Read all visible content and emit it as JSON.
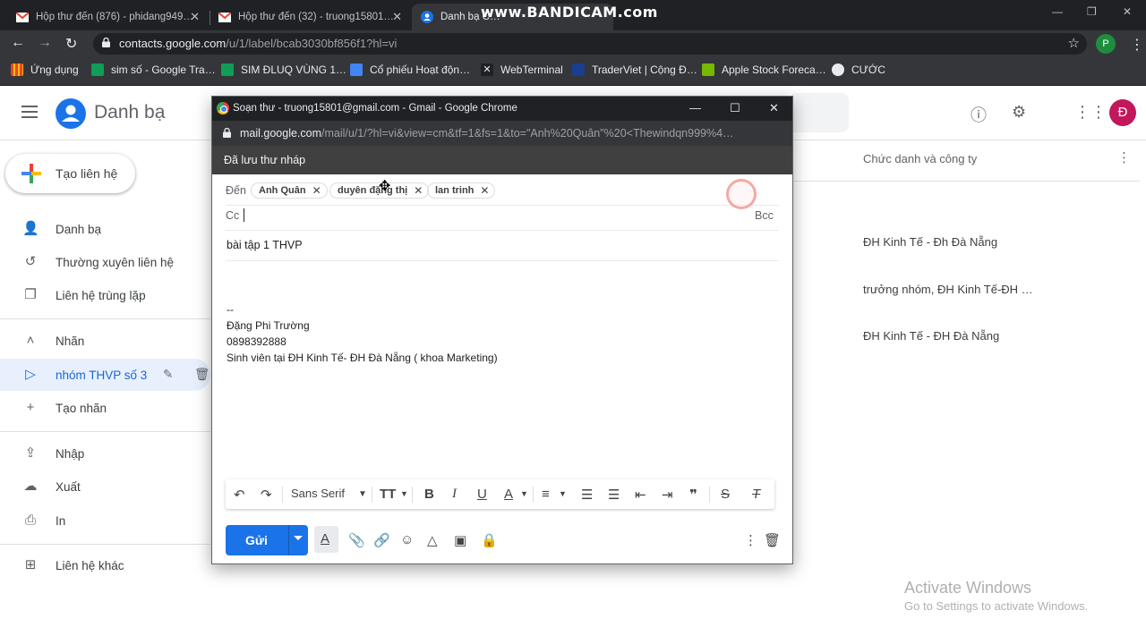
{
  "browser": {
    "tabs": [
      {
        "title": "Hộp thư đến (876) - phidang949…",
        "icon": "gmail-icon"
      },
      {
        "title": "Hộp thư đến (32) - truong15801…",
        "icon": "gmail-icon"
      },
      {
        "title": "Danh bạ C…",
        "icon": "contacts-icon"
      }
    ],
    "watermark": "www.BANDICAM.com",
    "address": {
      "host": "contacts.google.com",
      "path": "/u/1/label/bcab3030bf856f1?hl=vi"
    },
    "profile_initial": "P",
    "bookmarks": [
      {
        "label": "Ứng dụng",
        "icon": "apps-grid-icon",
        "color": "#ea4335"
      },
      {
        "label": "sim số - Google Tra…",
        "icon": "sheets-icon",
        "color": "#0f9d58"
      },
      {
        "label": "SIM ĐLUQ VÙNG 1…",
        "icon": "sheets-icon",
        "color": "#0f9d58"
      },
      {
        "label": "Cổ phiếu Hoạt độn…",
        "icon": "page-icon",
        "color": "#4285f4"
      },
      {
        "label": "WebTerminal",
        "icon": "terminal-icon",
        "color": "#202124"
      },
      {
        "label": "TraderViet | Cộng Đ…",
        "icon": "traderviet-icon",
        "color": "#1a3f91"
      },
      {
        "label": "Apple Stock Foreca…",
        "icon": "stock-icon",
        "color": "#76b900"
      },
      {
        "label": "CƯỚC",
        "icon": "globe-icon",
        "color": "#e8eaed"
      }
    ]
  },
  "contacts": {
    "app_title": "Danh bạ",
    "create_label": "Tạo liên hệ",
    "avatar_initial": "Đ",
    "sidebar": [
      {
        "label": "Danh bạ",
        "icon": "person-icon"
      },
      {
        "label": "Thường xuyên liên hệ",
        "icon": "history-icon"
      },
      {
        "label": "Liên hệ trùng lặp",
        "icon": "copy-icon"
      },
      {
        "label": "Nhãn",
        "icon": "chevron-up-icon"
      },
      {
        "label": "nhóm THVP số 3",
        "icon": "label-icon"
      },
      {
        "label": "Tạo nhãn",
        "icon": "plus-icon"
      },
      {
        "label": "Nhập",
        "icon": "upload-icon"
      },
      {
        "label": "Xuất",
        "icon": "cloud-download-icon"
      },
      {
        "label": "In",
        "icon": "print-icon"
      },
      {
        "label": "Liên hệ khác",
        "icon": "archive-icon"
      }
    ],
    "column_header": "Chức danh và công ty",
    "rows": [
      "ĐH Kinh Tế - Đh Đà Nẵng",
      "trưởng nhóm, ĐH Kinh Tế-ĐH …",
      "ĐH Kinh Tế - ĐH Đà Nẵng"
    ]
  },
  "activation": {
    "title": "Activate Windows",
    "subtitle": "Go to Settings to activate Windows."
  },
  "compose_window": {
    "title": "Soạn thư - truong15801@gmail.com - Gmail - Google Chrome",
    "url_host": "mail.google.com",
    "url_path": "/mail/u/1/?hl=vi&view=cm&tf=1&fs=1&to=\"Anh%20Quân\"%20<Thewindqn999%4…",
    "draft_status": "Đã lưu thư nháp",
    "to_label": "Đến",
    "recipients": [
      "Anh Quân",
      "duyên đặng thị",
      "lan trinh"
    ],
    "cc_label": "Cc",
    "bcc_label": "Bcc",
    "subject": "bài tập 1  THVP",
    "signature": [
      "--",
      "Đặng Phi Trường",
      "0898392888",
      "Sinh viên tại ĐH Kinh Tế- ĐH Đà Nẵng ( khoa Marketing)"
    ],
    "font_name": "Sans Serif",
    "send_label": "Gửi"
  }
}
